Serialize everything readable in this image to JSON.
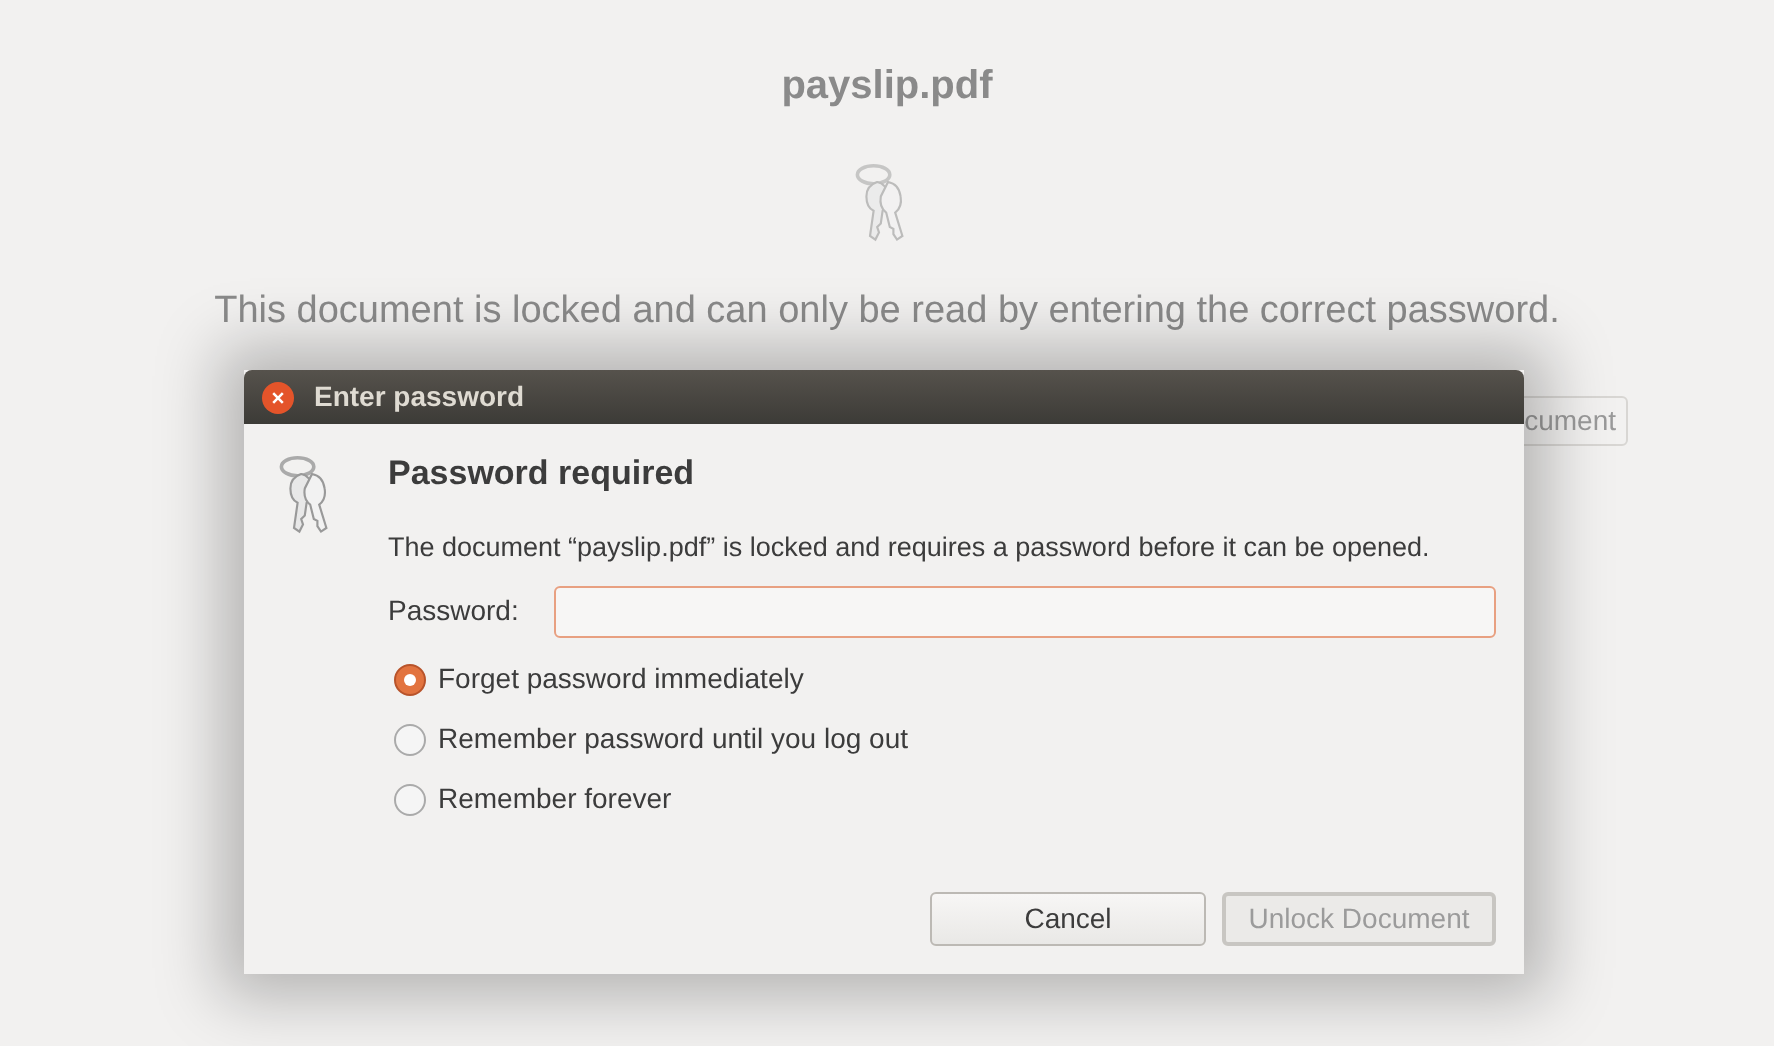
{
  "document": {
    "title": "payslip.pdf",
    "message": "This document is locked and can only be read by entering the correct password.",
    "button_fragment": "cument"
  },
  "dialog": {
    "title": "Enter password",
    "heading": "Password required",
    "description": "The document “payslip.pdf” is locked and requires a password before it can be opened.",
    "password_label": "Password:",
    "options": [
      {
        "label": "Forget password immediately",
        "selected": true
      },
      {
        "label": "Remember password until you log out",
        "selected": false
      },
      {
        "label": "Remember forever",
        "selected": false
      }
    ],
    "buttons": [
      {
        "label": "Cancel",
        "disabled": false
      },
      {
        "label": "Unlock Document",
        "disabled": true
      }
    ]
  }
}
